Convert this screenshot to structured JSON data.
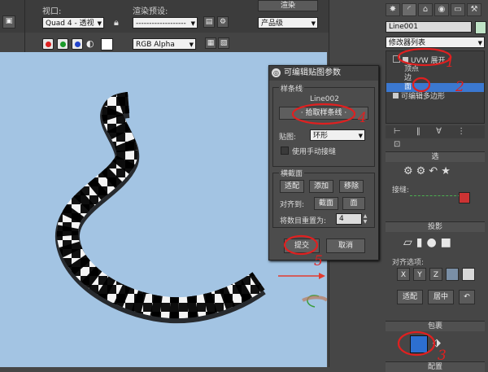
{
  "toolbar": {
    "viewport_label": "视口:",
    "viewport_value": "Quad 4 - 透视",
    "preset_label": "渲染预设:",
    "preset_value": "-------------------",
    "render_btn": "渲染",
    "quality_value": "产品级",
    "channel_value": "RGB Alpha"
  },
  "right_panel": {
    "object_name": "Line001",
    "modifier_list": "修改器列表",
    "stack": {
      "uvw_unwrap": "UVW 展开",
      "vertex": "顶点",
      "edge": "边",
      "face": "面",
      "editable_poly": "可编辑多边形"
    },
    "rollout_selection": "选",
    "stitch_label": "接缝:",
    "projection_header": "投影",
    "align_label": "对齐选项:",
    "align_x": "X",
    "align_y": "Y",
    "align_z": "Z",
    "fit_btn": "适配",
    "center_btn": "居中",
    "wrap_header": "包裹",
    "bottom_header": "配置"
  },
  "dialog": {
    "title": "可编辑贴图参数",
    "spline_group": "样条线",
    "spline_name": "Line002",
    "pick_spline_btn": "· 拾取样条线 ·",
    "map_label": "贴图:",
    "map_value": "环形",
    "manual_seam": "使用手动接缝",
    "cross_group": "横截面",
    "fit_btn": "适配",
    "add_btn": "添加",
    "remove_btn": "移除",
    "align_to_label": "对齐到:",
    "section_btn": "截面",
    "face_btn": "面",
    "reset_count_label": "将数目重置为:",
    "reset_count_value": "4",
    "commit_btn": "提交",
    "cancel_btn": "取消"
  },
  "annotations": [
    "1",
    "2",
    "4",
    "5",
    "3"
  ],
  "colors": {
    "viewport_bg": "#a3c4e3",
    "annotation": "#e02020",
    "selected_row": "#3b78d0",
    "checker_dark": "#111111",
    "checker_light": "#f4f4f4"
  }
}
